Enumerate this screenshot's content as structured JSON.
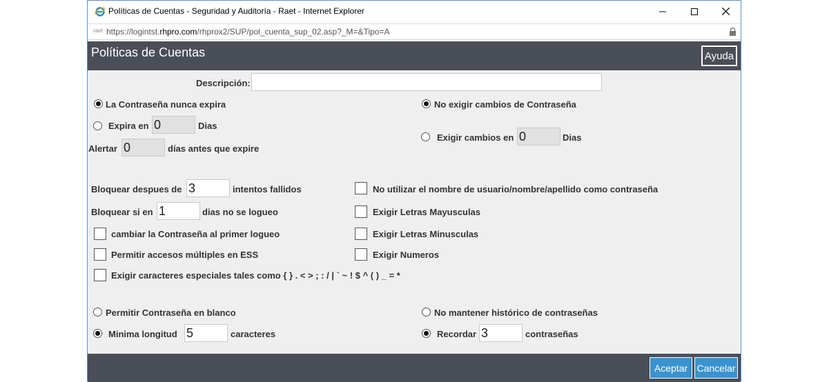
{
  "window": {
    "title": "Políticas de Cuentas - Seguridad y Auditoría - Raet - Internet Explorer",
    "favicon_text": "raet",
    "url_prefix": "https://logintst.",
    "url_domain": "rhpro.com",
    "url_path": "/rhprox2/SUP/pol_cuenta_sup_02.asp?_M=&Tipo=A"
  },
  "header": {
    "title": "Políticas de Cuentas",
    "help_label": "Ayuda"
  },
  "form": {
    "descripcion_label": "Descripción:",
    "descripcion_value": "",
    "expiry": {
      "never_label": "La Contraseña nunca expira",
      "expires_in_label": "Expira en",
      "expires_in_value": "0",
      "days_label": "Dias",
      "alert_label": "Alertar",
      "alert_value": "0",
      "alert_suffix": "días antes que expire",
      "selected": "never"
    },
    "changes": {
      "no_require_label": "No exigir cambios de Contraseña",
      "require_in_label": "Exigir cambios en",
      "require_in_value": "0",
      "days_label": "Dias",
      "selected": "no_require"
    },
    "lock": {
      "after_label": "Bloquear despues de",
      "after_value": "3",
      "after_suffix": "intentos fallidos",
      "inactive_label": "Bloquear si en",
      "inactive_value": "1",
      "inactive_suffix": "dias no se logueo"
    },
    "checkboxes_left": [
      {
        "label": "cambiar la Contraseña al primer logueo",
        "checked": false
      },
      {
        "label": "Permitir accesos múltiples en ESS",
        "checked": false
      },
      {
        "label": "Exigir caracteres especiales tales como { } . < > ; : / | ` ~ ! $ ^ ( ) _ = *",
        "checked": false
      }
    ],
    "checkboxes_right": [
      {
        "label": "No utilizar el nombre de usuario/nombre/apellido como contraseña",
        "checked": false
      },
      {
        "label": "Exigir Letras Mayusculas",
        "checked": false
      },
      {
        "label": "Exigir Letras Minusculas",
        "checked": false
      },
      {
        "label": "Exigir Numeros",
        "checked": false
      }
    ],
    "blank": {
      "allow_blank_label": "Permitir Contraseña en blanco",
      "min_length_label": "Minima longitud",
      "min_length_value": "5",
      "min_length_suffix": "caracteres",
      "selected": "min_length"
    },
    "history": {
      "no_history_label": "No mantener histórico de contraseñas",
      "remember_label": "Recordar",
      "remember_value": "3",
      "remember_suffix": "contraseñas",
      "selected": "remember"
    }
  },
  "footer": {
    "accept_label": "Aceptar",
    "cancel_label": "Cancelar"
  }
}
